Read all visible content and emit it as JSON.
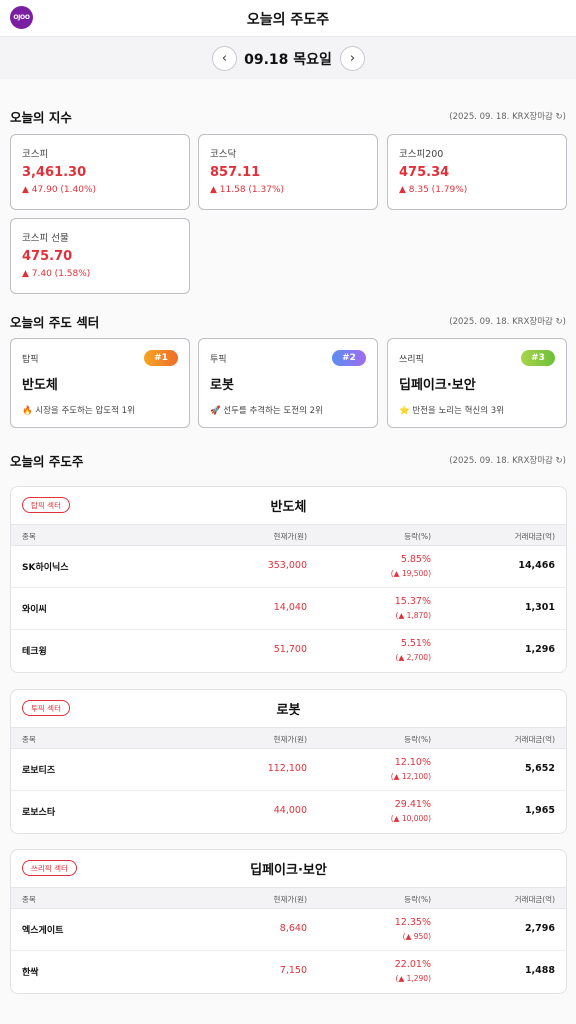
{
  "app": {
    "logo": "OJOO",
    "title": "오늘의 주도주"
  },
  "date_nav": {
    "prev_icon": "chevron-left-icon",
    "next_icon": "chevron-right-icon",
    "date": "09.18 목요일"
  },
  "indices": {
    "title": "오늘의 지수",
    "meta": "(2025. 09. 18. KRX장마감 ↻)",
    "items": [
      {
        "name": "코스피",
        "value": "3,461.30",
        "change": "▲ 47.90 (1.40%)"
      },
      {
        "name": "코스닥",
        "value": "857.11",
        "change": "▲ 11.58 (1.37%)"
      },
      {
        "name": "코스피200",
        "value": "475.34",
        "change": "▲ 8.35 (1.79%)"
      },
      {
        "name": "코스피 선물",
        "value": "475.70",
        "change": "▲ 7.40 (1.58%)"
      }
    ]
  },
  "sectors": {
    "title": "오늘의 주도 섹터",
    "meta": "(2025. 09. 18. KRX장마감 ↻)",
    "items": [
      {
        "rank_label": "탑픽",
        "badge": "#1",
        "badge_color": "#f08a24",
        "name": "반도체",
        "desc": "🔥 시장을 주도하는 압도적 1위"
      },
      {
        "rank_label": "투픽",
        "badge": "#2",
        "badge_color": "#7c6cf0",
        "name": "로봇",
        "desc": "🚀 선두를 추격하는 도전의 2위"
      },
      {
        "rank_label": "쓰리픽",
        "badge": "#3",
        "badge_color": "#8cc63f",
        "name": "딥페이크·보안",
        "desc": "⭐ 반전을 노리는 혁신의 3위"
      }
    ]
  },
  "leaders": {
    "title": "오늘의 주도주",
    "meta": "(2025. 09. 18. KRX장마감 ↻)",
    "columns": {
      "name": "종목",
      "price": "현재가(원)",
      "rate": "등락(%)",
      "volume": "거래대금(억)"
    },
    "groups": [
      {
        "badge": "탑픽 섹터",
        "title": "반도체",
        "rows": [
          {
            "name": "SK하이닉스",
            "price": "353,000",
            "rate": "5.85%",
            "diff": "(▲ 19,500)",
            "volume": "14,466"
          },
          {
            "name": "와이씨",
            "price": "14,040",
            "rate": "15.37%",
            "diff": "(▲ 1,870)",
            "volume": "1,301"
          },
          {
            "name": "테크윙",
            "price": "51,700",
            "rate": "5.51%",
            "diff": "(▲ 2,700)",
            "volume": "1,296"
          }
        ]
      },
      {
        "badge": "투픽 섹터",
        "title": "로봇",
        "rows": [
          {
            "name": "로보티즈",
            "price": "112,100",
            "rate": "12.10%",
            "diff": "(▲ 12,100)",
            "volume": "5,652"
          },
          {
            "name": "로보스타",
            "price": "44,000",
            "rate": "29.41%",
            "diff": "(▲ 10,000)",
            "volume": "1,965"
          }
        ]
      },
      {
        "badge": "쓰리픽 섹터",
        "title": "딥페이크·보안",
        "rows": [
          {
            "name": "엑스게이트",
            "price": "8,640",
            "rate": "12.35%",
            "diff": "(▲ 950)",
            "volume": "2,796"
          },
          {
            "name": "한싹",
            "price": "7,150",
            "rate": "22.01%",
            "diff": "(▲ 1,290)",
            "volume": "1,488"
          }
        ]
      }
    ]
  },
  "colors": {
    "up": "#e0313a",
    "brand": "#7b1fa2"
  }
}
